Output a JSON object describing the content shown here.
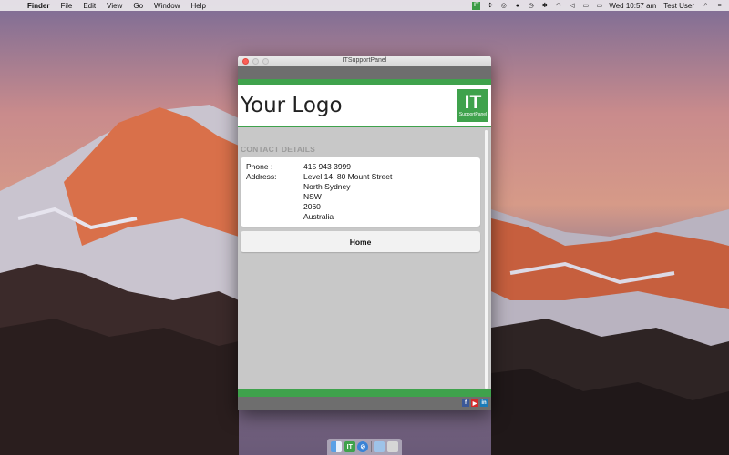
{
  "menubar": {
    "app_name": "Finder",
    "menus": [
      "File",
      "Edit",
      "View",
      "Go",
      "Window",
      "Help"
    ],
    "tray_it_label": "IT",
    "clock": "Wed 10:57 am",
    "user": "Test User"
  },
  "window": {
    "title": "ITSupportPanel",
    "logo_text": "Your Logo",
    "brand_letters": "IT",
    "brand_subtitle": "SupportPanel",
    "section_title": "CONTACT DETAILS",
    "phone_label": "Phone :",
    "phone_value": "415 943 3999",
    "address_label": "Address:",
    "address_lines": [
      "Level 14, 80 Mount Street",
      "North Sydney",
      "NSW",
      "2060",
      "Australia"
    ],
    "home_button": "Home",
    "social": [
      "f",
      "▶",
      "in"
    ]
  },
  "dock": {
    "it_label": "IT"
  },
  "colors": {
    "brand_green": "#3fa24c",
    "band_gray": "#6e6e6e",
    "content_bg": "#c8c8c8"
  }
}
